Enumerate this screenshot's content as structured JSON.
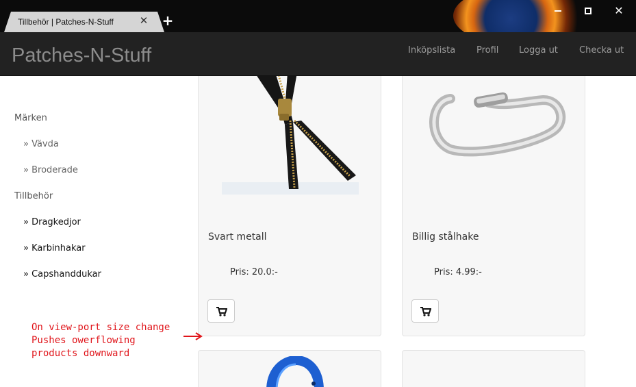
{
  "browser": {
    "tab_title": "Tillbehör | Patches-N-Stuff",
    "tab_close": "✕",
    "new_tab": "+",
    "close_glyph": "✕",
    "icons": [
      "firefox-logo",
      "minimize-icon",
      "maximize-icon",
      "close-icon"
    ]
  },
  "navbar": {
    "brand": "Patches-N-Stuff",
    "links": [
      "Inköpslista",
      "Profil",
      "Logga ut",
      "Checka ut"
    ]
  },
  "sidebar": {
    "sections": [
      {
        "heading": "Märken",
        "items": [
          "» Vävda",
          "» Broderade"
        ]
      },
      {
        "heading": "Tillbehör",
        "items": [
          "» Dragkedjor",
          "» Karbinhakar",
          "» Capshanddukar"
        ]
      }
    ]
  },
  "products": [
    {
      "title": "Svart metall",
      "price": "Pris: 20.0:-",
      "image": "black-zipper"
    },
    {
      "title": "Billig stålhake",
      "price": "Pris: 4.99:-",
      "image": "steel-carabiner"
    },
    {
      "title": "",
      "price": "",
      "image": "blue-carabiner"
    },
    {
      "title": "",
      "price": "",
      "image": ""
    }
  ],
  "annotation": {
    "lines": [
      "On view-port size change",
      "Pushes owerflowing",
      "products downward"
    ],
    "arrow": "⟶"
  },
  "colors": {
    "navbar_bg": "#222222",
    "brand": "#8c8c8c",
    "annotation": "#e0141a",
    "card_bg": "#f7f7f7"
  }
}
